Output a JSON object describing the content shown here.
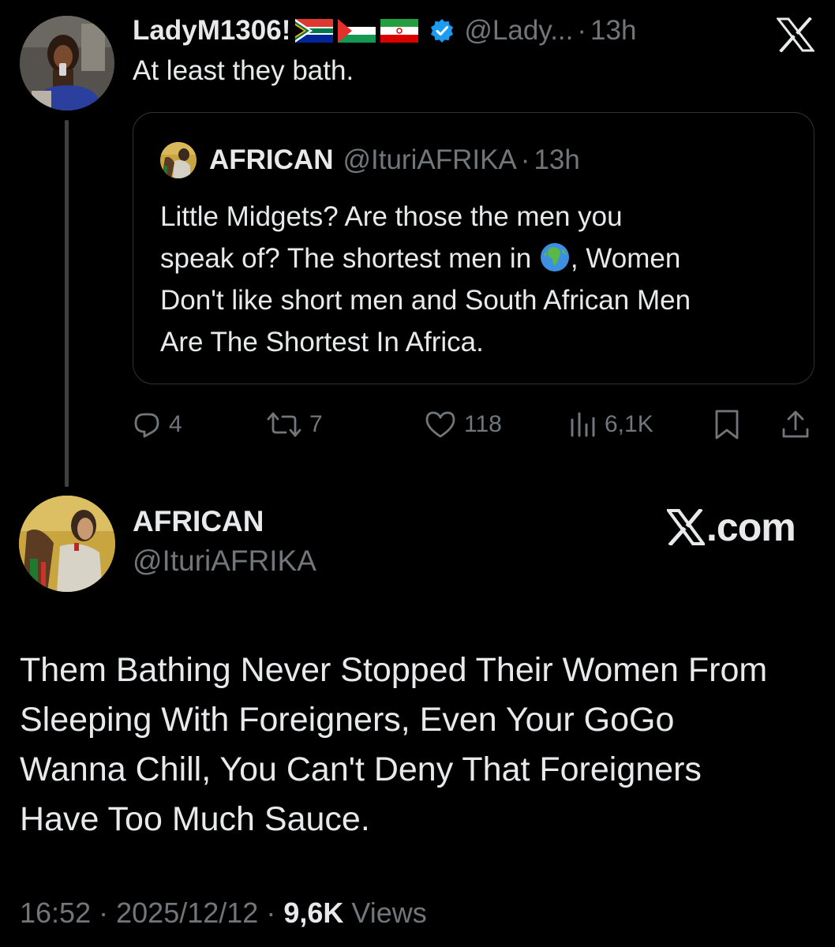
{
  "reply_tweet": {
    "display_name": "LadyM1306!",
    "flags": [
      "south-africa-flag",
      "palestine-flag",
      "iran-flag"
    ],
    "verified": true,
    "handle": "@Lady...",
    "separator": "·",
    "time": "13h",
    "text": "At least they bath."
  },
  "quoted_tweet": {
    "display_name": "AFRICAN",
    "handle": "@IturiAFRIKA",
    "separator": "·",
    "time": "13h",
    "text_lines": [
      "Little Midgets? Are those the men you",
      "speak of? The shortest men in",
      ",  Women",
      "Don't like short men and South African Men",
      "Are The Shortest In Africa."
    ],
    "emoji": "globe-africa-icon"
  },
  "actions": {
    "replies": "4",
    "reposts": "7",
    "likes": "118",
    "views": "6,1K"
  },
  "top_logo": "x-logo",
  "main_tweet": {
    "display_name": "AFRICAN",
    "handle": "@IturiAFRIKA",
    "brand": ".com",
    "text_lines": [
      "Them Bathing Never Stopped Their Women From",
      "Sleeping With Foreigners, Even Your GoGo",
      "Wanna Chill, You Can't Deny That Foreigners",
      "Have Too Much Sauce."
    ],
    "time": "16:52",
    "separator": "·",
    "date": "2025/12/12",
    "views_count": "9,6K",
    "views_label": "Views"
  },
  "colors": {
    "background": "#000000",
    "text": "#e7e9ea",
    "muted": "#71767b",
    "verified": "#1d9bf0",
    "border": "#2f3336"
  }
}
